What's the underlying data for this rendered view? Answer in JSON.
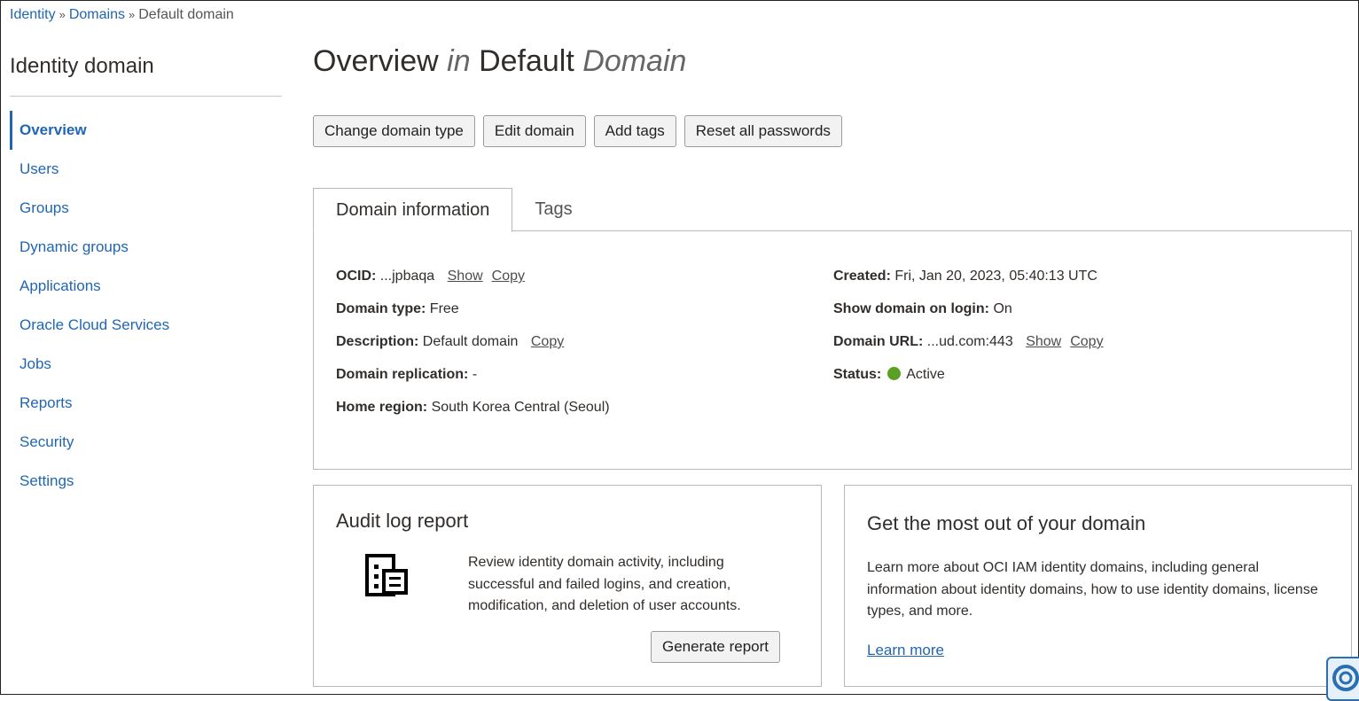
{
  "breadcrumb": {
    "identity": "Identity",
    "domains": "Domains",
    "current": "Default domain",
    "separator": "»"
  },
  "sidebar": {
    "title": "Identity domain",
    "items": [
      {
        "label": "Overview",
        "active": true
      },
      {
        "label": "Users"
      },
      {
        "label": "Groups"
      },
      {
        "label": "Dynamic groups"
      },
      {
        "label": "Applications"
      },
      {
        "label": "Oracle Cloud Services"
      },
      {
        "label": "Jobs"
      },
      {
        "label": "Reports"
      },
      {
        "label": "Security"
      },
      {
        "label": "Settings"
      }
    ]
  },
  "header": {
    "title_part1": "Overview",
    "title_in": "in",
    "title_part2": "Default",
    "title_domain": "Domain"
  },
  "toolbar": {
    "change_domain_type": "Change domain type",
    "edit_domain": "Edit domain",
    "add_tags": "Add tags",
    "reset_passwords": "Reset all passwords"
  },
  "tabs": [
    {
      "label": "Domain information",
      "active": true
    },
    {
      "label": "Tags"
    }
  ],
  "domain_info": {
    "ocid_label": "OCID:",
    "ocid_value": "...jpbaqa",
    "show": "Show",
    "copy": "Copy",
    "domain_type_label": "Domain type:",
    "domain_type_value": "Free",
    "description_label": "Description:",
    "description_value": "Default domain",
    "replication_label": "Domain replication:",
    "replication_value": "-",
    "home_region_label": "Home region:",
    "home_region_value": "South Korea Central (Seoul)",
    "created_label": "Created:",
    "created_value": "Fri, Jan 20, 2023, 05:40:13 UTC",
    "show_on_login_label": "Show domain on login:",
    "show_on_login_value": "On",
    "domain_url_label": "Domain URL:",
    "domain_url_value": "...ud.com:443",
    "status_label": "Status:",
    "status_value": "Active",
    "status_color": "#5aa025"
  },
  "audit_card": {
    "title": "Audit log report",
    "text": "Review identity domain activity, including successful and failed logins, and creation, modification, and deletion of user accounts.",
    "button": "Generate report"
  },
  "learn_card": {
    "title": "Get the most out of your domain",
    "text": "Learn more about OCI IAM identity domains, including general information about identity domains, how to use identity domains, license types, and more.",
    "link": "Learn more"
  },
  "colors": {
    "link": "#2166b2",
    "text": "#312d2a"
  }
}
